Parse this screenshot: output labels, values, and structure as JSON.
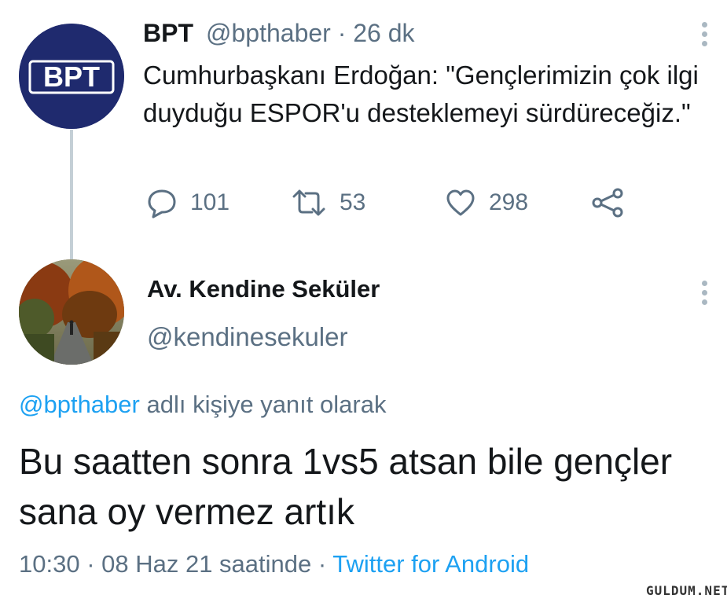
{
  "original_tweet": {
    "avatar_text": "BPT",
    "name": "BPT",
    "handle_time": "@bpthaber · 26 dk",
    "text": "Cumhurbaşkanı Erdoğan: \"Gençlerimizin çok ilgi duyduğu ESPOR'u desteklemeyi sürdüreceğiz.\"",
    "actions": {
      "replies": "101",
      "retweets": "53",
      "likes": "298"
    }
  },
  "reply_tweet": {
    "name": "Av. Kendine Seküler",
    "handle": "@kendinesekuler",
    "reply_to_mention": "@bpthaber",
    "reply_to_suffix": " adlı kişiye yanıt olarak",
    "text": "Bu saatten sonra 1vs5 atsan bile gençler sana oy vermez artık",
    "timestamp": "10:30 · 08 Haz 21 saatinde · ",
    "source": "Twitter for Android"
  },
  "watermark": "GULDUM.NET",
  "colors": {
    "accent": "#1da1f2",
    "secondary_text": "#5b7083",
    "avatar_bpt_bg": "#1f2a6e"
  }
}
